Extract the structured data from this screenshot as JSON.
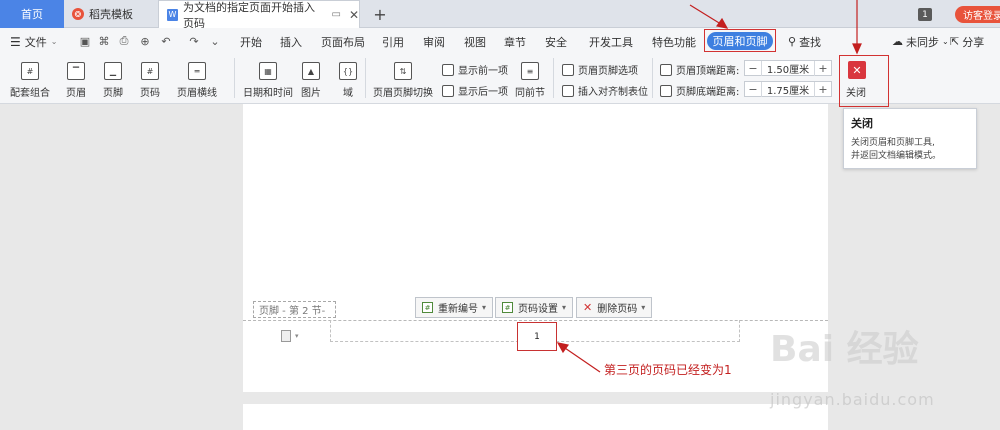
{
  "tabs": {
    "home": "首页",
    "template": "稻壳模板",
    "doc_title": "为文档的指定页面开始插入页码",
    "new": "+",
    "page_count": "1",
    "visitor": "访客登录"
  },
  "menu": {
    "file": "文件",
    "items": [
      "开始",
      "插入",
      "页面布局",
      "引用",
      "审阅",
      "视图",
      "章节",
      "安全",
      "开发工具",
      "特色功能",
      "页眉和页脚"
    ],
    "search": "查找",
    "sync": "未同步",
    "share": "分享"
  },
  "ribbon": {
    "match_combo": "配套组合",
    "header": "页眉",
    "footer": "页脚",
    "page_num": "页码",
    "header_line": "页眉横线",
    "datetime": "日期和时间",
    "picture": "图片",
    "field": "域",
    "switch": "页眉页脚切换",
    "show_prev": "显示前一项",
    "show_next": "显示后一项",
    "same_prev": "同前节",
    "options": "页眉页脚选项",
    "insert_tab": "插入对齐制表位",
    "header_top_label": "页眉顶端距离:",
    "header_top_value": "1.50厘米",
    "footer_bottom_label": "页脚底端距离:",
    "footer_bottom_value": "1.75厘米",
    "close": "关闭"
  },
  "tooltip": {
    "title": "关闭",
    "desc_line1": "关闭页眉和页脚工具,",
    "desc_line2": "并返回文档编辑模式。"
  },
  "document": {
    "footer_tag": "页脚 - 第 2 节-",
    "renumber": "重新编号",
    "page_setting": "页码设置",
    "delete_page_num": "删除页码",
    "page_number_value": "1",
    "annotation": "第三页的页码已经变为1"
  },
  "watermark": {
    "main": "Bai 经验",
    "sub": "jingyan.baidu.com"
  },
  "colors": {
    "accent": "#3d7fe0",
    "highlight_red": "#d23232",
    "close_red": "#d9363e"
  }
}
